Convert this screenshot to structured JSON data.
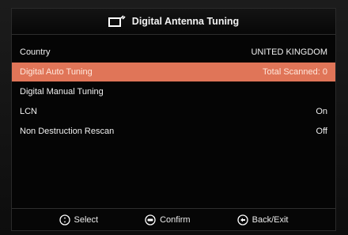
{
  "header": {
    "title": "Digital Antenna Tuning",
    "icon": "antenna-tv-icon"
  },
  "menu": {
    "items": [
      {
        "label": "Country",
        "value": "UNITED KINGDOM",
        "selected": false
      },
      {
        "label": "Digital Auto Tuning",
        "value": "Total Scanned: 0",
        "selected": true
      },
      {
        "label": "Digital Manual Tuning",
        "value": "",
        "selected": false
      },
      {
        "label": "LCN",
        "value": "On",
        "selected": false
      },
      {
        "label": "Non Destruction Rescan",
        "value": "Off",
        "selected": false
      }
    ]
  },
  "footer": {
    "select_label": "Select",
    "confirm_label": "Confirm",
    "back_label": "Back/Exit"
  },
  "colors": {
    "highlight": "#e07558",
    "background": "#050505",
    "text": "#f0f0f0"
  }
}
